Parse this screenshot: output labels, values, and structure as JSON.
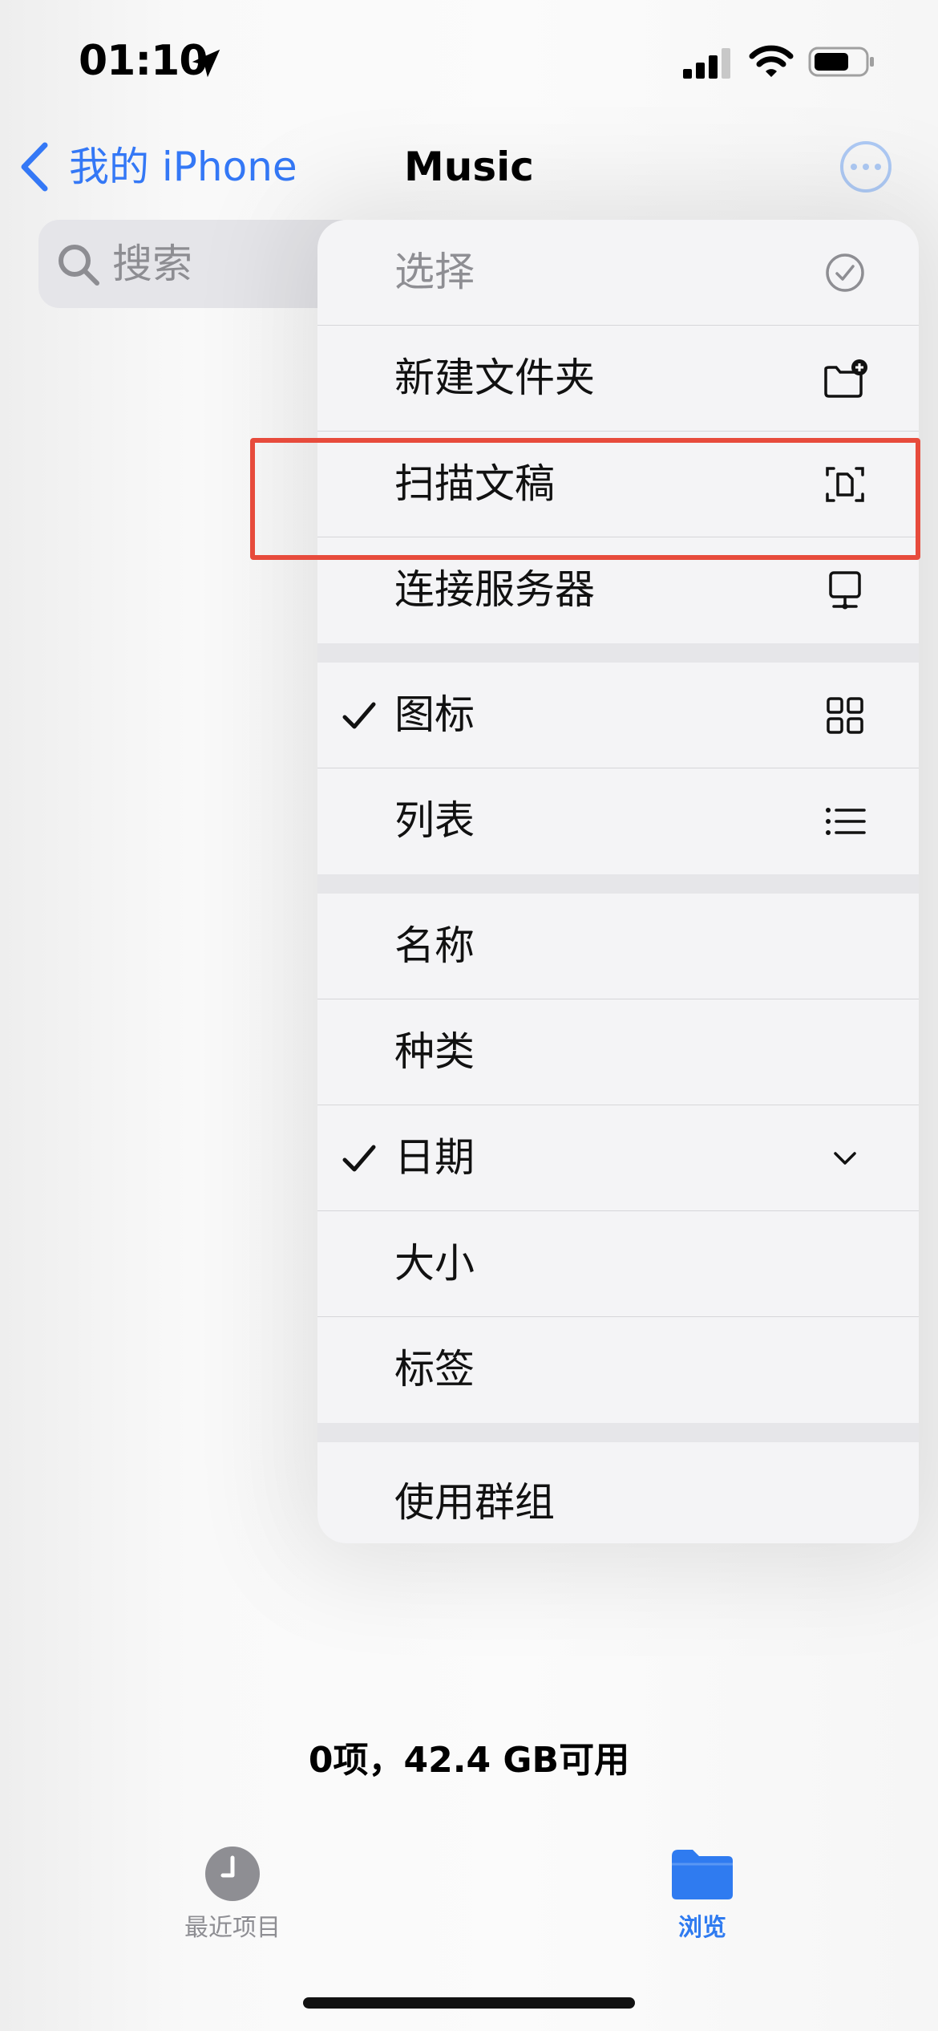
{
  "status_bar": {
    "time": "01:10"
  },
  "nav": {
    "back_label": "我的 iPhone",
    "title": "Music"
  },
  "search": {
    "placeholder": "搜索"
  },
  "menu": {
    "select": "选择",
    "new_folder": "新建文件夹",
    "scan_documents": "扫描文稿",
    "connect_server": "连接服务器",
    "view_icons": "图标",
    "view_list": "列表",
    "sort_name": "名称",
    "sort_kind": "种类",
    "sort_date": "日期",
    "sort_size": "大小",
    "sort_tags": "标签",
    "use_groups": "使用群组"
  },
  "menu_state": {
    "selected_view": "图标",
    "selected_sort": "日期",
    "sort_direction": "descending"
  },
  "footer": {
    "item_count": "0项，42.4 GB可用"
  },
  "tab_bar": {
    "recents": "最近项目",
    "browse": "浏览",
    "active": "浏览"
  },
  "highlight": {
    "target": "扫描文稿",
    "color": "#e74b3c"
  },
  "colors": {
    "accent": "#3478f6",
    "tab_active": "#2f7bf0"
  }
}
